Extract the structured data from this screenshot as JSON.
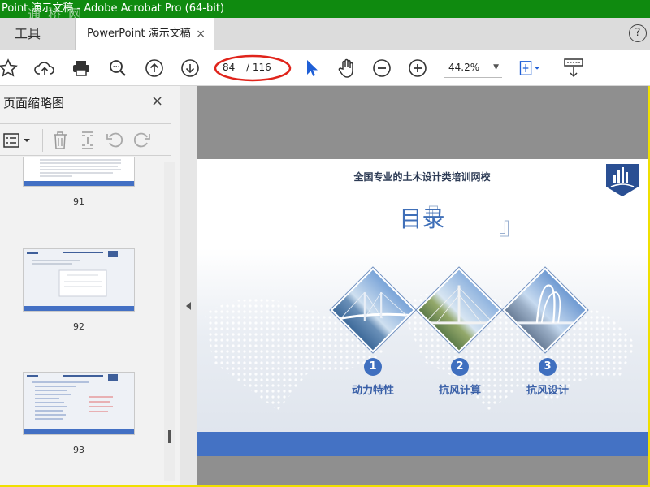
{
  "window": {
    "title": "Point 演示文稿 - Adobe Acrobat Pro (64-bit)",
    "watermark": "通 桥 网"
  },
  "tabs": {
    "tools_label": "工具",
    "document_label": "PowerPoint 演示文稿",
    "close_glyph": "×",
    "help_glyph": "?"
  },
  "toolbar": {
    "current_page": "84",
    "total_pages": "/ 116",
    "zoom": "44.2%",
    "highlight_color": "#e0241b"
  },
  "sidebar": {
    "title": "页面缩略图",
    "close_glyph": "×",
    "thumbnails": [
      {
        "number": "91"
      },
      {
        "number": "92"
      },
      {
        "number": "93"
      }
    ]
  },
  "slide": {
    "school": "全国专业的土木设计类培训网校",
    "heading": "目录",
    "bracket_left": "『",
    "bracket_right": "』",
    "items": [
      {
        "number": "1",
        "label": "动力特性"
      },
      {
        "number": "2",
        "label": "抗风计算"
      },
      {
        "number": "3",
        "label": "抗风设计"
      }
    ],
    "accent_color": "#4472c4"
  }
}
